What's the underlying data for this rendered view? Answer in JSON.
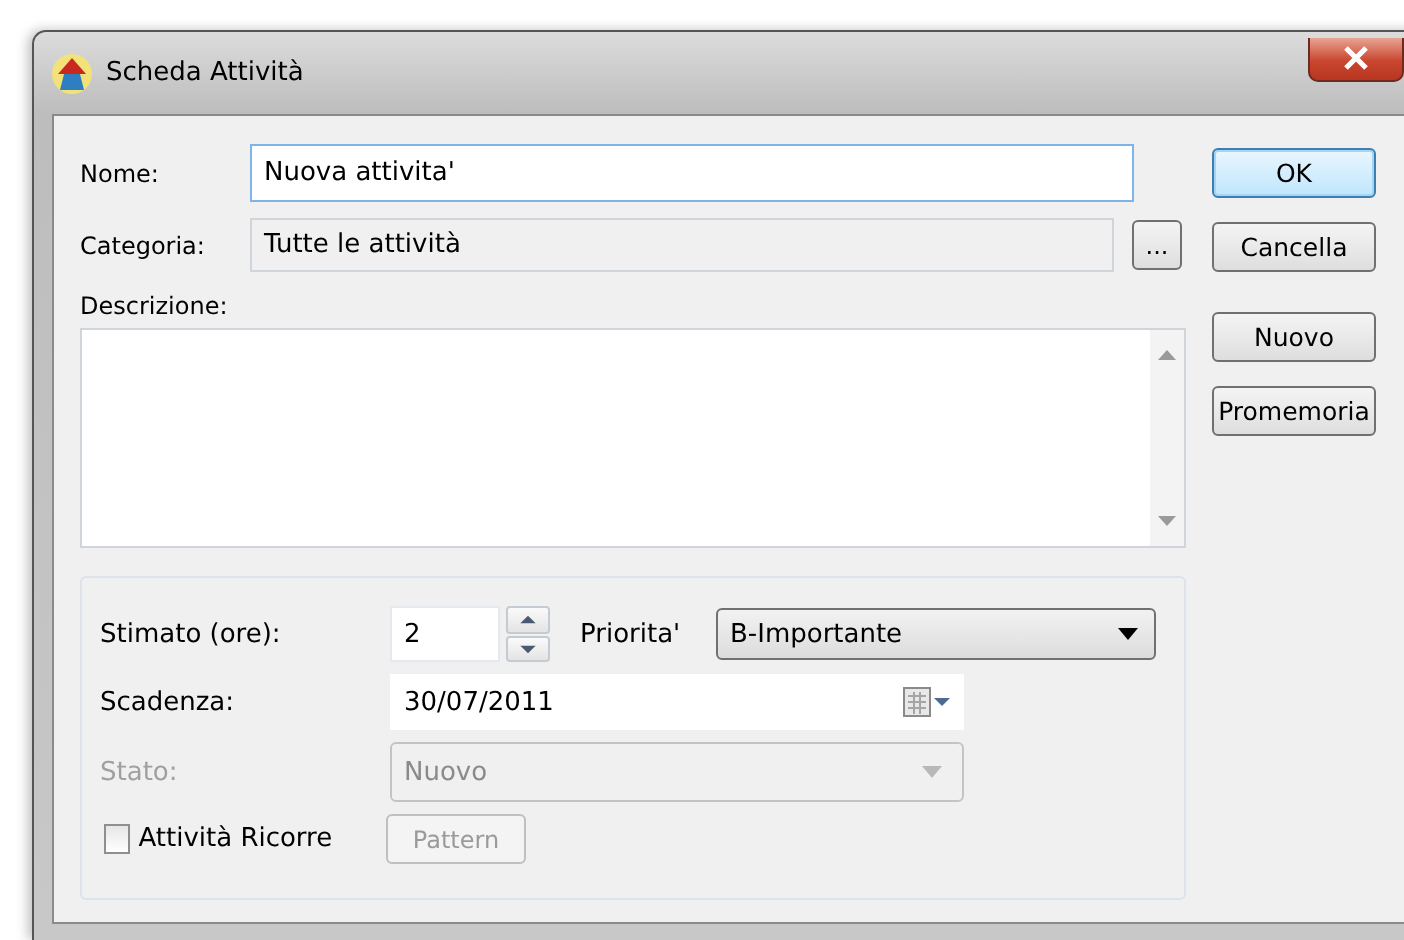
{
  "window": {
    "title": "Scheda Attività"
  },
  "name": {
    "label": "Nome:",
    "value": "Nuova attivita'"
  },
  "category": {
    "label": "Categoria:",
    "value": "Tutte le attività",
    "browse_button": "..."
  },
  "description": {
    "label": "Descrizione:"
  },
  "estimate": {
    "label": "Stimato (ore):",
    "value": "2"
  },
  "priority": {
    "label": "Priorita'",
    "value": "B-Importante"
  },
  "due": {
    "label": "Scadenza:",
    "value": "30/07/2011"
  },
  "status": {
    "label": "Stato:",
    "value": "Nuovo",
    "disabled": true
  },
  "recurring": {
    "label": "Attività Ricorre",
    "checked": false
  },
  "pattern_button": {
    "label": "Pattern",
    "disabled": true
  },
  "buttons": [
    {
      "label": "OK",
      "default": true
    },
    {
      "label": "Cancella",
      "default": false
    },
    {
      "label": "Nuovo",
      "default": false
    },
    {
      "label": "Promemoria",
      "default": false
    }
  ]
}
